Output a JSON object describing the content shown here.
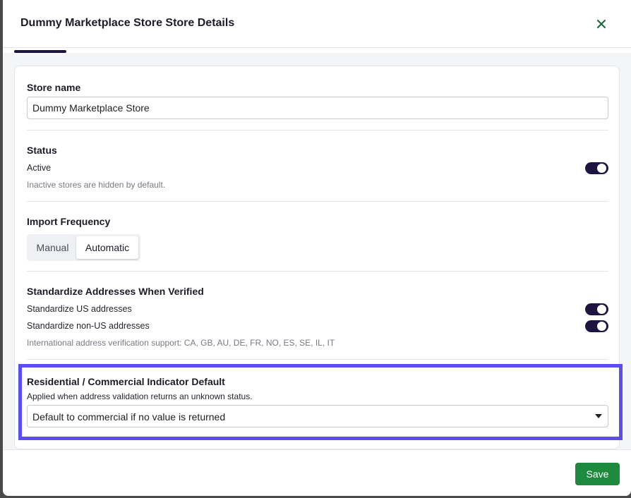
{
  "modal": {
    "title": "Dummy Marketplace Store Store Details"
  },
  "store_name": {
    "label": "Store name",
    "value": "Dummy Marketplace Store"
  },
  "status": {
    "title": "Status",
    "active_label": "Active",
    "active_on": true,
    "help": "Inactive stores are hidden by default."
  },
  "import_frequency": {
    "title": "Import Frequency",
    "options": [
      "Manual",
      "Automatic"
    ],
    "selected": "Automatic"
  },
  "standardize": {
    "title": "Standardize Addresses When Verified",
    "us_label": "Standardize US addresses",
    "us_on": true,
    "non_us_label": "Standardize non-US addresses",
    "non_us_on": true,
    "help": "International address verification support: CA, GB, AU, DE, FR, NO, ES, SE, IL, IT"
  },
  "residential": {
    "title": "Residential / Commercial Indicator Default",
    "help": "Applied when address validation returns an unknown status.",
    "selected": "Default to commercial if no value is returned"
  },
  "footer": {
    "save_label": "Save"
  },
  "colors": {
    "accent": "#1d1440",
    "save_button": "#1e8a3e",
    "highlight": "#5b4df0",
    "close_icon": "#1e6b3a"
  },
  "icons": {
    "close": "close-icon",
    "toggle": "toggle-switch",
    "dropdown": "caret-down-icon"
  }
}
